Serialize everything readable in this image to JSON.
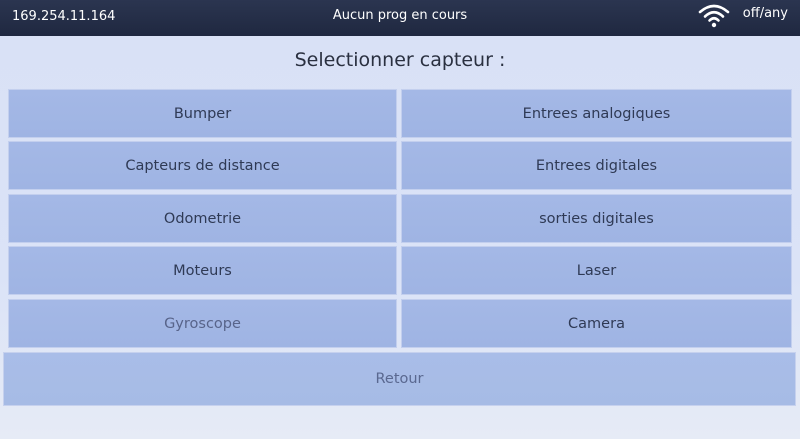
{
  "statusbar": {
    "ip": "169.254.11.164",
    "program_status": "Aucun prog en cours",
    "wifi_icon": "wifi-icon",
    "mode": "off/any"
  },
  "title": "Selectionner capteur :",
  "buttons_left": [
    "Bumper",
    "Capteurs de distance",
    "Odometrie",
    "Moteurs",
    "Gyroscope"
  ],
  "buttons_right": [
    "Entrees analogiques",
    "Entrees digitales",
    "sorties digitales",
    "Laser",
    "Camera"
  ],
  "back_label": "Retour"
}
